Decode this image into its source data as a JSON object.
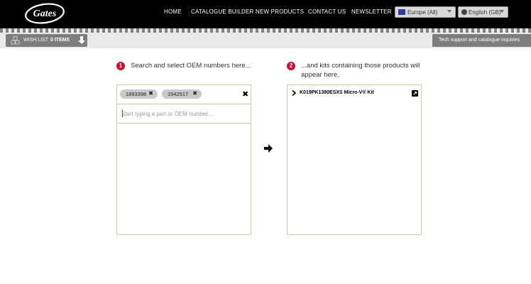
{
  "header": {
    "logo_text": "Gates",
    "nav": [
      "HOME",
      "CATALOGUE BUILDER",
      "NEW PRODUCTS",
      "CONTACT US",
      "NEWSLETTER"
    ],
    "region_select": "Europe (All)",
    "language_select": "English (GB)"
  },
  "toolbar": {
    "wishlist_label": "WISH LIST",
    "wishlist_count": "0 ITEMS",
    "tech_support": "Tech support and catalogue inquiries"
  },
  "step1": {
    "number": "1",
    "text": "Search and select OEM numbers here..."
  },
  "step2": {
    "number": "2",
    "text": "...and kits containing those products will appear here."
  },
  "search": {
    "tags": [
      "1893398",
      "1942517"
    ],
    "placeholder": "Start typing a part or OEM number...",
    "value": ""
  },
  "results": {
    "kits": [
      {
        "label": "K019PK1380ESXS Micro-V® Kit"
      }
    ]
  },
  "colors": {
    "header_bg": "#000000",
    "accent_red": "#c8102e",
    "button_grey": "#7d7d7d",
    "panel_border": "#cfc8a8"
  },
  "icons": {
    "wishlist": "wishlist-cubes-icon",
    "download": "arrow-down-icon",
    "arrow": "arrow-right-icon",
    "chevron": "chevron-right-icon",
    "external": "external-link-icon"
  }
}
